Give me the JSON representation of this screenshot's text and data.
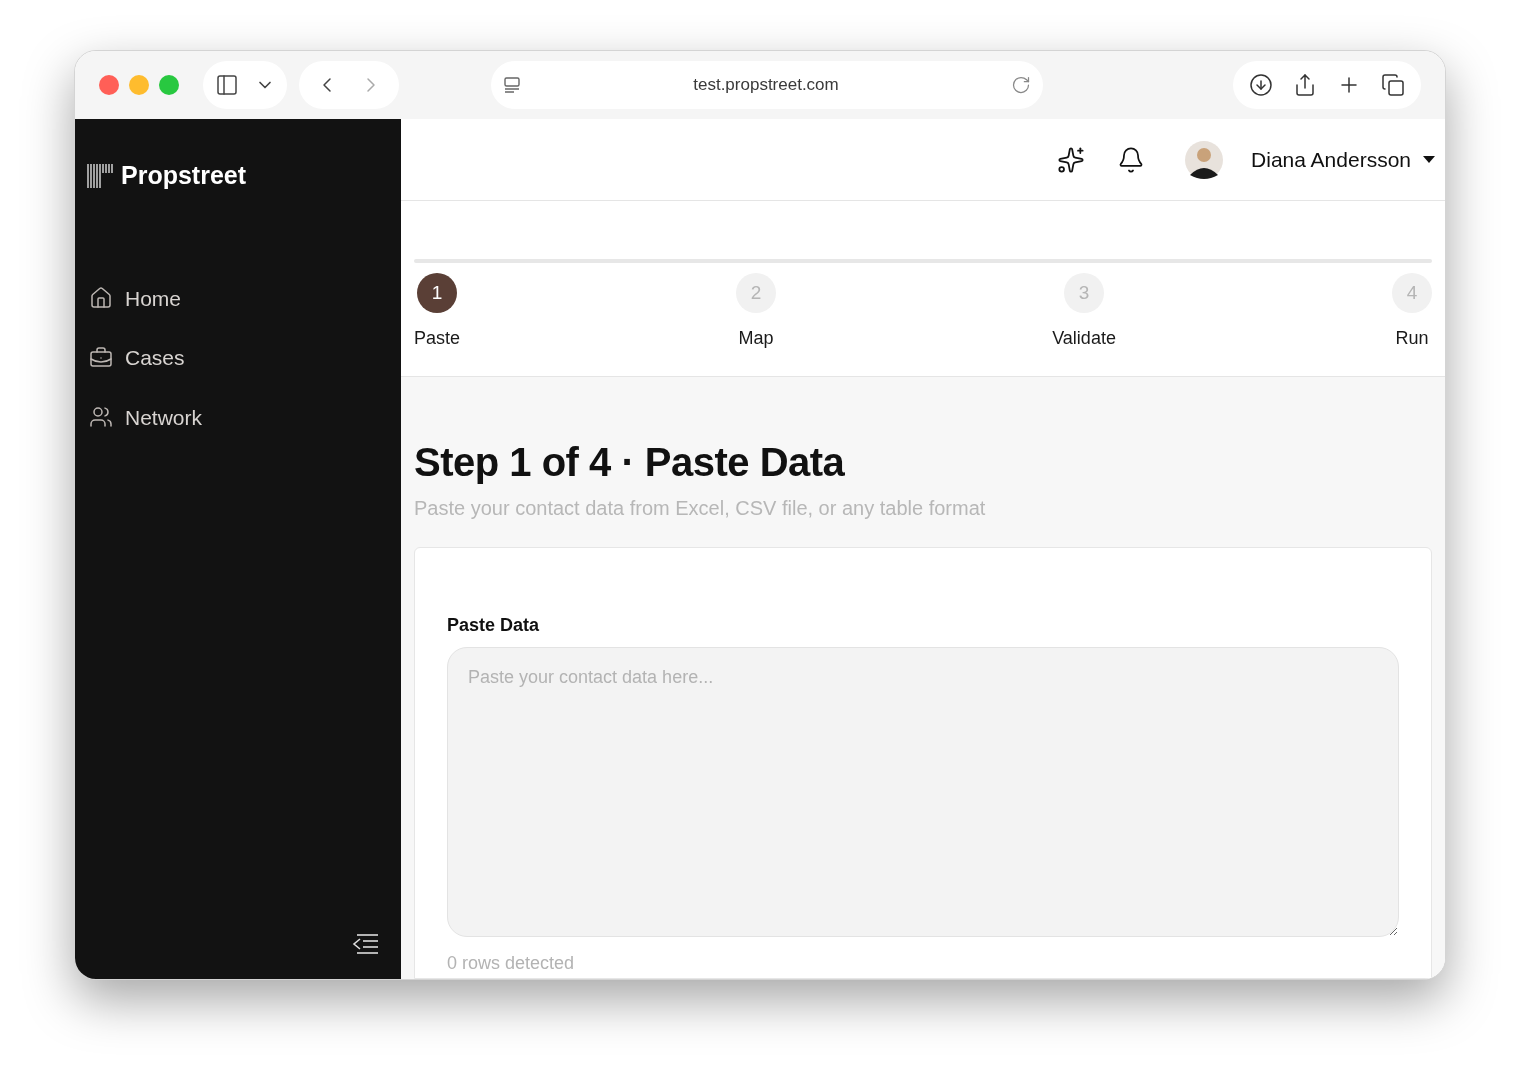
{
  "browser": {
    "url": "test.propstreet.com"
  },
  "sidebar": {
    "brand": "Propstreet",
    "items": [
      {
        "label": "Home",
        "kind": "home"
      },
      {
        "label": "Cases",
        "kind": "cases"
      },
      {
        "label": "Network",
        "kind": "network"
      }
    ]
  },
  "header": {
    "user_name": "Diana Andersson"
  },
  "stepper": {
    "steps": [
      {
        "number": "1",
        "label": "Paste",
        "selected": true
      },
      {
        "number": "2",
        "label": "Map",
        "selected": false
      },
      {
        "number": "3",
        "label": "Validate",
        "selected": false
      },
      {
        "number": "4",
        "label": "Run",
        "selected": false
      }
    ]
  },
  "page": {
    "title": "Step 1 of 4 · Paste Data",
    "subtitle": "Paste your contact data from Excel, CSV file, or any table format"
  },
  "form": {
    "label": "Paste Data",
    "placeholder": "Paste your contact data here...",
    "status": "0 rows detected"
  }
}
